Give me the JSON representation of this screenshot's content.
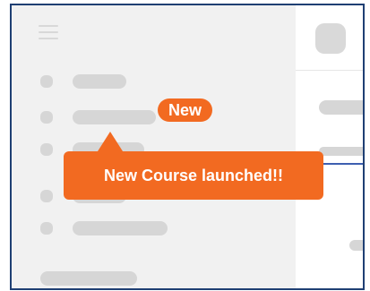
{
  "badge": {
    "label": "New"
  },
  "tooltip": {
    "message": "New Course launched!!"
  },
  "colors": {
    "accent": "#f26a21",
    "frame": "#1f3f73",
    "sidebar_bg": "#f1f1f1",
    "placeholder": "#d6d6d6"
  },
  "icons": {
    "menu": "hamburger-icon"
  }
}
